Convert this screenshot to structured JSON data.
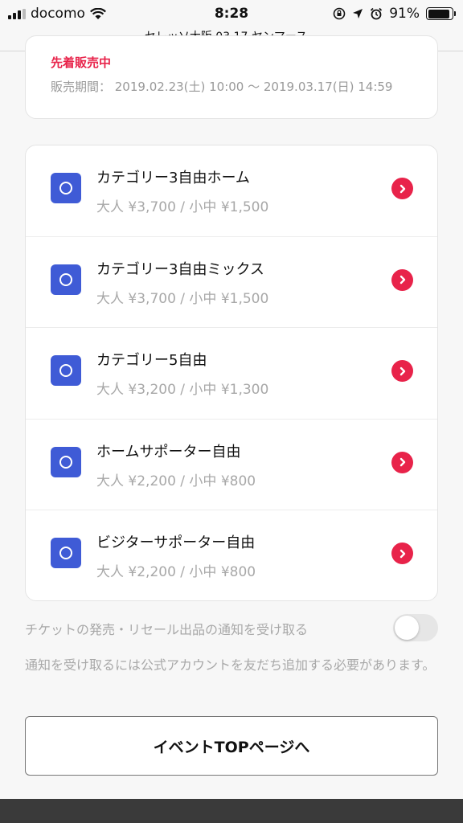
{
  "status_bar": {
    "carrier": "docomo",
    "time": "8:28",
    "battery_percent": "91%",
    "battery_level": 0.91
  },
  "url_bar": {
    "title": "セレッソ大阪 03.17 ヤンマース…"
  },
  "sale_info": {
    "status": "先着販売中",
    "period": "販売期間： 2019.02.23(土) 10:00 〜 2019.03.17(日) 14:59"
  },
  "tickets": [
    {
      "name": "カテゴリー3自由ホーム",
      "price": "大人 ¥3,700 / 小中 ¥1,500"
    },
    {
      "name": "カテゴリー3自由ミックス",
      "price": "大人 ¥3,700 / 小中 ¥1,500"
    },
    {
      "name": "カテゴリー5自由",
      "price": "大人 ¥3,200 / 小中 ¥1,300"
    },
    {
      "name": "ホームサポーター自由",
      "price": "大人 ¥2,200 / 小中 ¥800"
    },
    {
      "name": "ビジターサポーター自由",
      "price": "大人 ¥2,200 / 小中 ¥800"
    }
  ],
  "notify": {
    "label": "チケットの発売・リセール出品の通知を受け取る",
    "enabled": false,
    "note": "通知を受け取るには公式アカウントを友だち追加する必要があります。"
  },
  "top_button": {
    "label": "イベントTOPページへ"
  },
  "colors": {
    "accent_red": "#e8234a",
    "icon_blue": "#3f5bd6"
  }
}
